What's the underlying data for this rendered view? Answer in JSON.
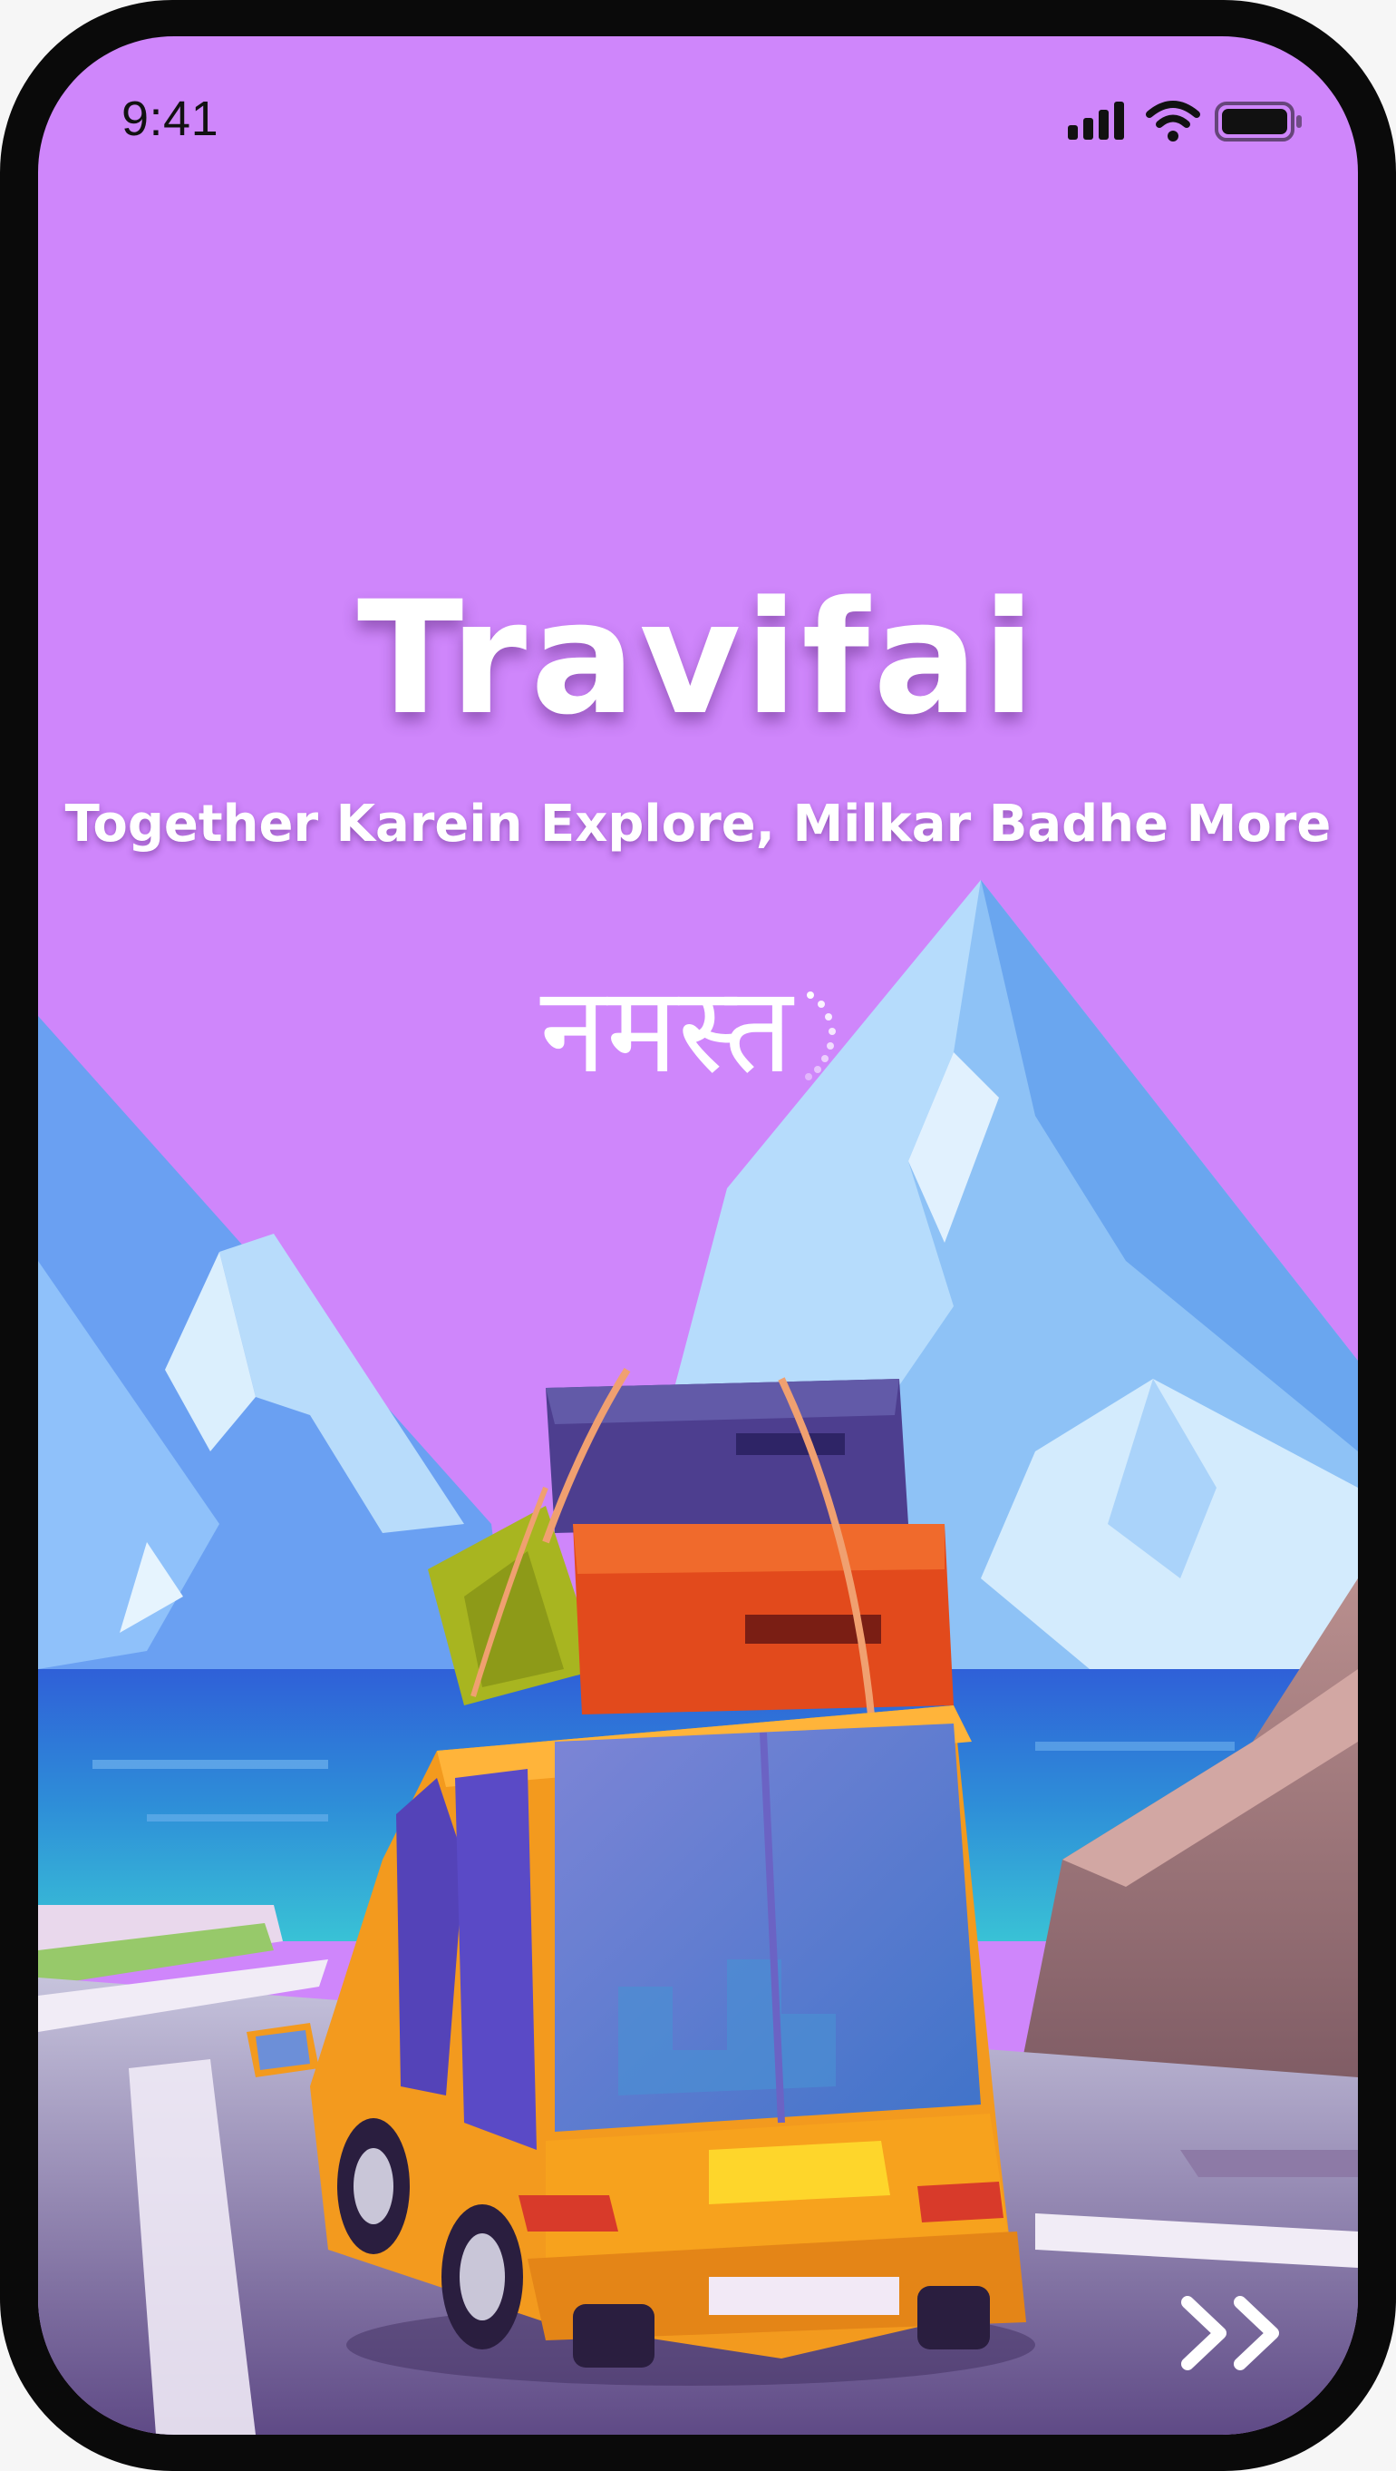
{
  "status_bar": {
    "time": "9:41"
  },
  "app": {
    "title": "Travifai",
    "tagline": "Together Karein Explore, Milkar Badhe More",
    "greeting": "नमस्त"
  },
  "icons": {
    "signal": "cellular-signal-icon",
    "wifi": "wifi-icon",
    "battery": "battery-icon",
    "next": "double-chevron-right-icon"
  },
  "colors": {
    "background": "#cf86fb",
    "title_text": "#ffffff",
    "van_body": "#f39a1e"
  }
}
